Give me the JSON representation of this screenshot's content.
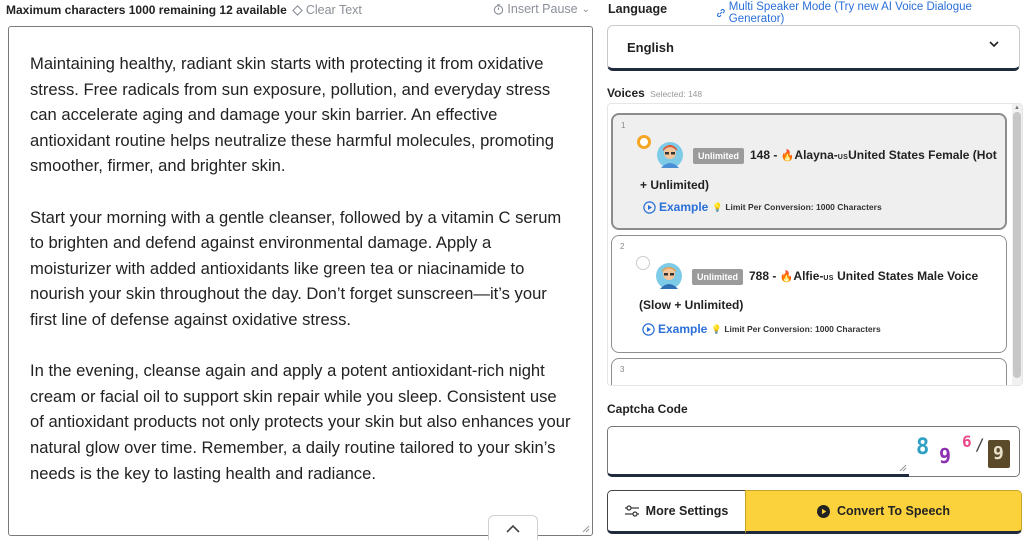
{
  "toolbar": {
    "max_chars_text": "Maximum characters 1000 remaining 12 available",
    "clear_text": "Clear Text",
    "insert_pause": "Insert Pause"
  },
  "editor": {
    "paragraphs": [
      "Maintaining healthy, radiant skin starts with protecting it from oxidative stress. Free radicals from sun exposure, pollution, and everyday stress can accelerate aging and damage your skin barrier. An effective antioxidant routine helps neutralize these harmful molecules, promoting smoother, firmer, and brighter skin.",
      "Start your morning with a gentle cleanser, followed by a vitamin C serum to brighten and defend against environmental damage. Apply a moisturizer with added antioxidants like green tea or niacinamide to nourish your skin throughout the day. Don’t forget sunscreen—it’s your first line of defense against oxidative stress.",
      "In the evening, cleanse again and apply a potent antioxidant-rich night cream or facial oil to support skin repair while you sleep. Consistent use of antioxidant products not only protects your skin but also enhances your natural glow over time. Remember, a daily routine tailored to your skin’s needs is the key to lasting health and radiance."
    ]
  },
  "language": {
    "label": "Language",
    "multi_speaker_link": "Multi Speaker Mode (Try new AI Voice Dialogue Generator)",
    "selected": "English"
  },
  "voices": {
    "label": "Voices",
    "selected_count": "Selected: 148",
    "items": [
      {
        "index": "1",
        "badge": "Unlimited",
        "id_prefix": "148 -",
        "name": "Alayna-",
        "country_code": "US",
        "desc_line1": "United States Female (Hot",
        "desc_line2": "+ Unlimited)",
        "example": "Example",
        "limit": "Limit Per Conversion: 1000 Characters",
        "selected": true
      },
      {
        "index": "2",
        "badge": "Unlimited",
        "id_prefix": "788 -",
        "name": "Alfie-",
        "country_code": "US",
        "desc_line1": " United States Male Voice",
        "desc_line2": "(Slow + Unlimited)",
        "example": "Example",
        "limit": "Limit Per Conversion: 1000 Characters",
        "selected": false
      },
      {
        "index": "3"
      }
    ]
  },
  "captcha": {
    "label": "Captcha Code",
    "chars": [
      "8",
      "9",
      "6",
      "/",
      "9"
    ]
  },
  "actions": {
    "more_settings": "More Settings",
    "convert": "Convert To Speech"
  },
  "colors": {
    "accent_yellow": "#fcd23c",
    "link_blue": "#2a6fd8",
    "radio_orange": "#f5a623"
  }
}
